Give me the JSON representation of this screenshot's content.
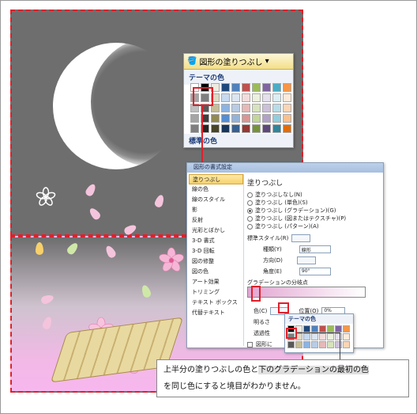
{
  "fill_button": {
    "label": "図形の塗りつぶし",
    "theme_colors": "テーマの色",
    "standard_colors": "標準の色"
  },
  "dialog": {
    "title": "図形の書式設定",
    "sidebar": [
      "塗りつぶし",
      "線の色",
      "線のスタイル",
      "影",
      "反射",
      "光彩とぼかし",
      "3-D 書式",
      "3-D 回転",
      "図の修整",
      "図の色",
      "アート効果",
      "トリミング",
      "テキスト ボックス",
      "代替テキスト"
    ],
    "heading": "塗りつぶし",
    "options": [
      "塗りつぶしなし(N)",
      "塗りつぶし (単色)(S)",
      "塗りつぶし (グラデーション)(G)",
      "塗りつぶし (図またはテクスチャ)(P)",
      "塗りつぶし (パターン)(A)"
    ],
    "preset_label": "標準スタイル(R)",
    "type_label": "種類(Y)",
    "type_value": "線形",
    "direction_label": "方向(D)",
    "angle_label": "角度(E)",
    "angle_value": "90°",
    "stops_label": "グラデーションの分岐点",
    "color_label": "色(C)",
    "position_label": "位置(O)",
    "position_value": "0%",
    "brightness_label": "明るさ",
    "transparency_label": "透過性",
    "rotate_label": "図形に",
    "popup_title": "テーマの色"
  },
  "note": {
    "line1_a": "上半分の塗りつぶしの色と",
    "line1_b": "下のグラデーションの最初の色",
    "line2": "を同じ色にすると境目がわかりません。"
  },
  "colors": {
    "accent_red": "#e0202a",
    "gray": "#6e6e6e",
    "pink": "#f7b7ee"
  }
}
